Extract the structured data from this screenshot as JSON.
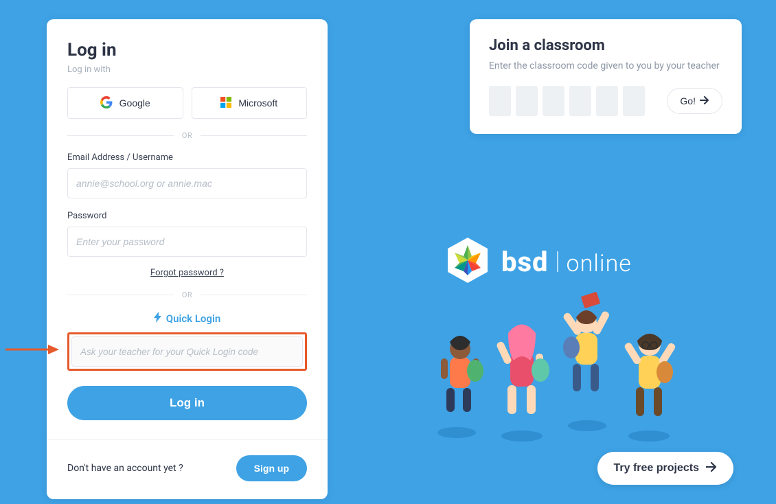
{
  "login": {
    "title": "Log in",
    "subtitle": "Log in with",
    "oauth": {
      "google": "Google",
      "microsoft": "Microsoft"
    },
    "or": "OR",
    "email_label": "Email Address / Username",
    "email_placeholder": "annie@school.org or annie.mac",
    "password_label": "Password",
    "password_placeholder": "Enter your password",
    "forgot": "Forgot password ?",
    "quick_login_label": "Quick Login",
    "quick_login_placeholder": "Ask your teacher for your Quick Login code",
    "login_button": "Log in",
    "signup_prompt": "Don't have an account yet ?",
    "signup_button": "Sign up"
  },
  "join": {
    "title": "Join a classroom",
    "subtitle": "Enter the classroom code given to you by your teacher",
    "go": "Go!"
  },
  "brand": {
    "name": "bsd",
    "suffix": "online"
  },
  "try_button": "Try free projects",
  "colors": {
    "accent": "#3ea2e5",
    "highlight": "#e55a2b"
  }
}
